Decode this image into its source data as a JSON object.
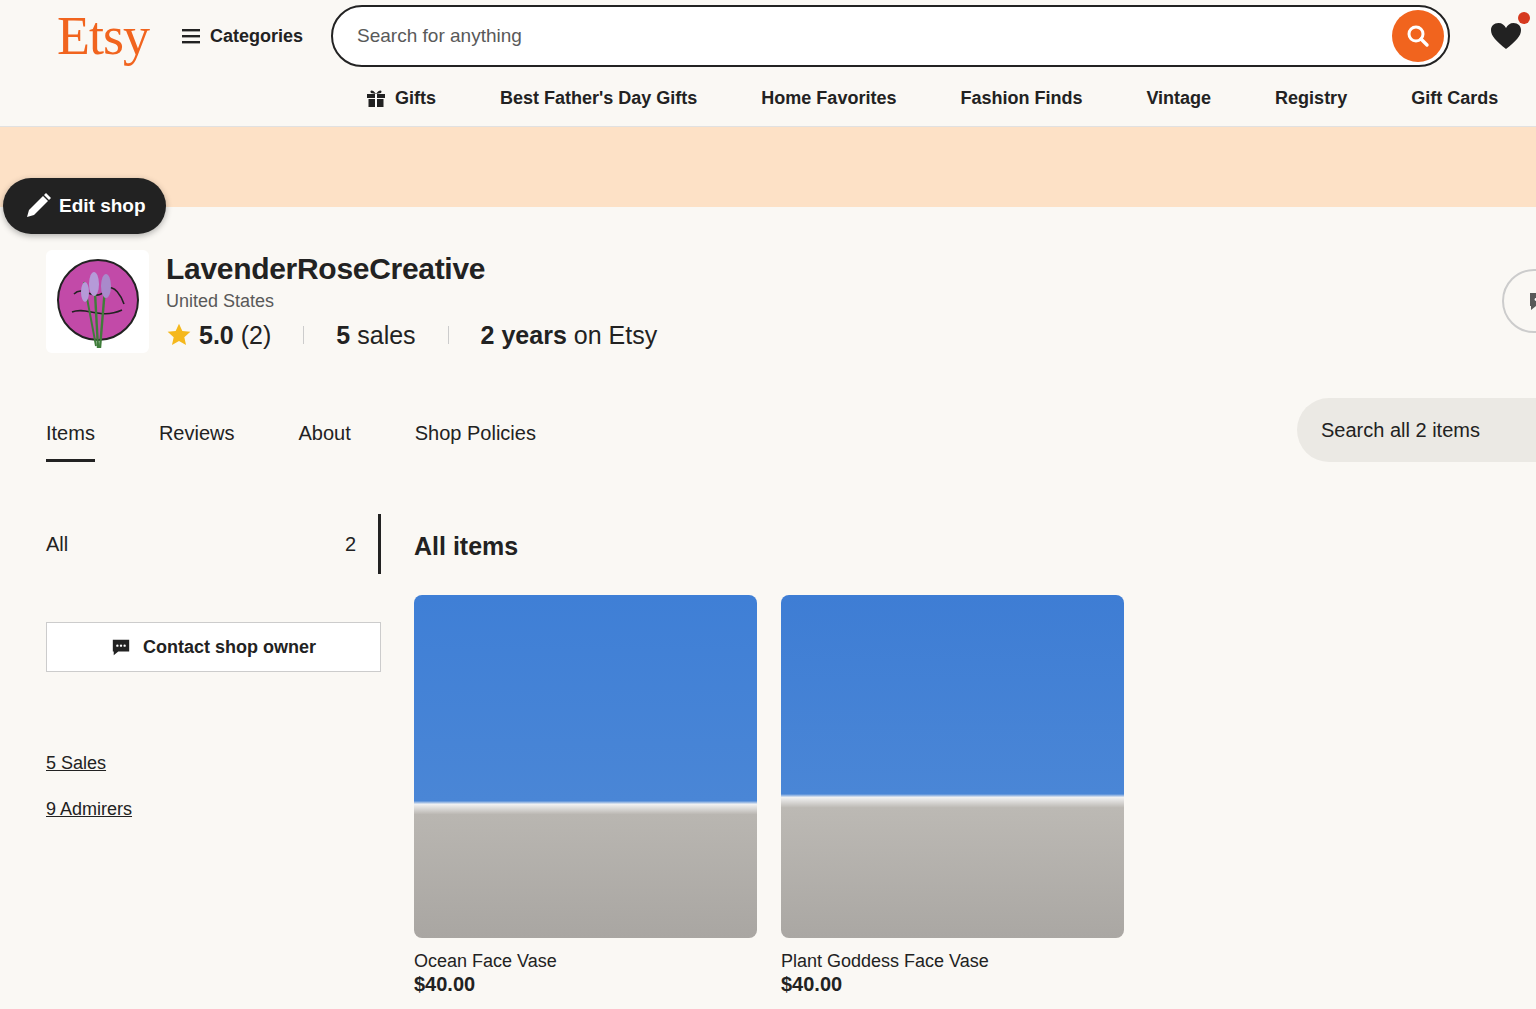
{
  "header": {
    "logo": "Etsy",
    "categories": "Categories",
    "search_placeholder": "Search for anything",
    "favorites_badge": true
  },
  "nav": [
    {
      "label": "Gifts",
      "kind": "gift"
    },
    {
      "label": "Best Father's Day Gifts",
      "kind": "text"
    },
    {
      "label": "Home Favorites",
      "kind": "text"
    },
    {
      "label": "Fashion Finds",
      "kind": "text"
    },
    {
      "label": "Vintage",
      "kind": "text"
    },
    {
      "label": "Registry",
      "kind": "text"
    },
    {
      "label": "Gift Cards",
      "kind": "text"
    }
  ],
  "edit_button": "Edit shop",
  "shop": {
    "name": "LavenderRoseCreative",
    "location": "United States",
    "rating": "5.0",
    "review_count": "(2)",
    "sales_count": "5",
    "sales_label": "sales",
    "age": "2 years",
    "age_label": "on Etsy"
  },
  "tabs": [
    {
      "label": "Items",
      "selected": true
    },
    {
      "label": "Reviews",
      "selected": false
    },
    {
      "label": "About",
      "selected": false
    },
    {
      "label": "Shop Policies",
      "selected": false
    }
  ],
  "item_search": {
    "placeholder": "Search all 2 items"
  },
  "sidebar": {
    "sections": [
      {
        "label": "All",
        "count": "2",
        "selected": true
      }
    ],
    "contact_button": "Contact shop owner",
    "links": [
      "5 Sales",
      "9 Admirers"
    ]
  },
  "main": {
    "title": "All items",
    "items": [
      {
        "title": "Ocean Face Vase",
        "price": "$40.00"
      },
      {
        "title": "Plant Goddess Face Vase",
        "price": "$40.00"
      }
    ]
  }
}
